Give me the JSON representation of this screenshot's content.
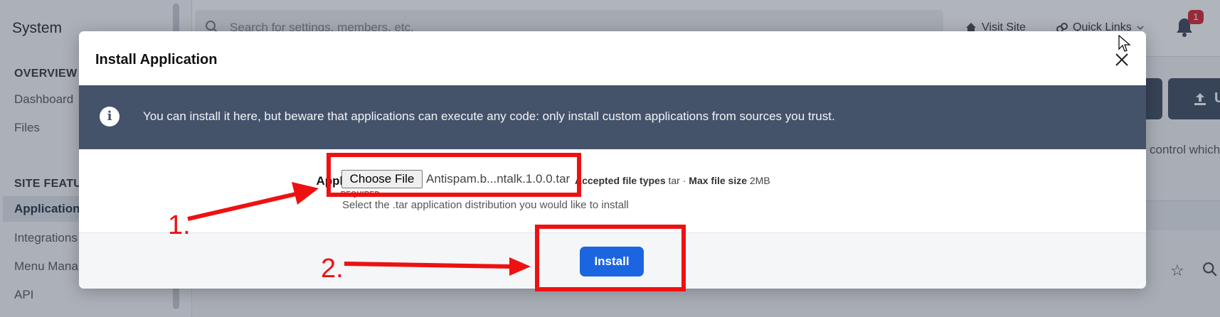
{
  "background": {
    "sidebar": {
      "title": "System",
      "sections": [
        "OVERVIEW",
        "SITE FEATU"
      ],
      "items": [
        "Dashboard",
        "Files",
        "Application",
        "Integrations",
        "Menu Mana",
        "API"
      ]
    },
    "search_placeholder": "Search for settings, members, etc.",
    "top_links": [
      "Visit Site",
      "Quick Links"
    ],
    "notification_count": "1",
    "button_label": "U",
    "description_fragment": "control which"
  },
  "modal": {
    "title": "Install Application",
    "info_text": "You can install it here, but beware that applications can execute any code: only install custom applications from sources you trust.",
    "field_label": "Application",
    "required_label": "REQUIRED",
    "choose_file_label": "Choose File",
    "file_name": "Antispam.b...ntalk.1.0.0.tar",
    "accepted_label": "Accepted file types",
    "accepted_value": "tar",
    "max_size_label": "Max file size",
    "max_size_value": "2MB",
    "help_text": "Select the .tar application distribution you would like to install",
    "install_label": "Install"
  },
  "annotations": {
    "step1": "1.",
    "step2": "2.",
    "color": "#ee1111"
  },
  "colors": {
    "info_bar": "#44536a",
    "primary_button": "#1b66e0",
    "required": "#c4202b"
  }
}
